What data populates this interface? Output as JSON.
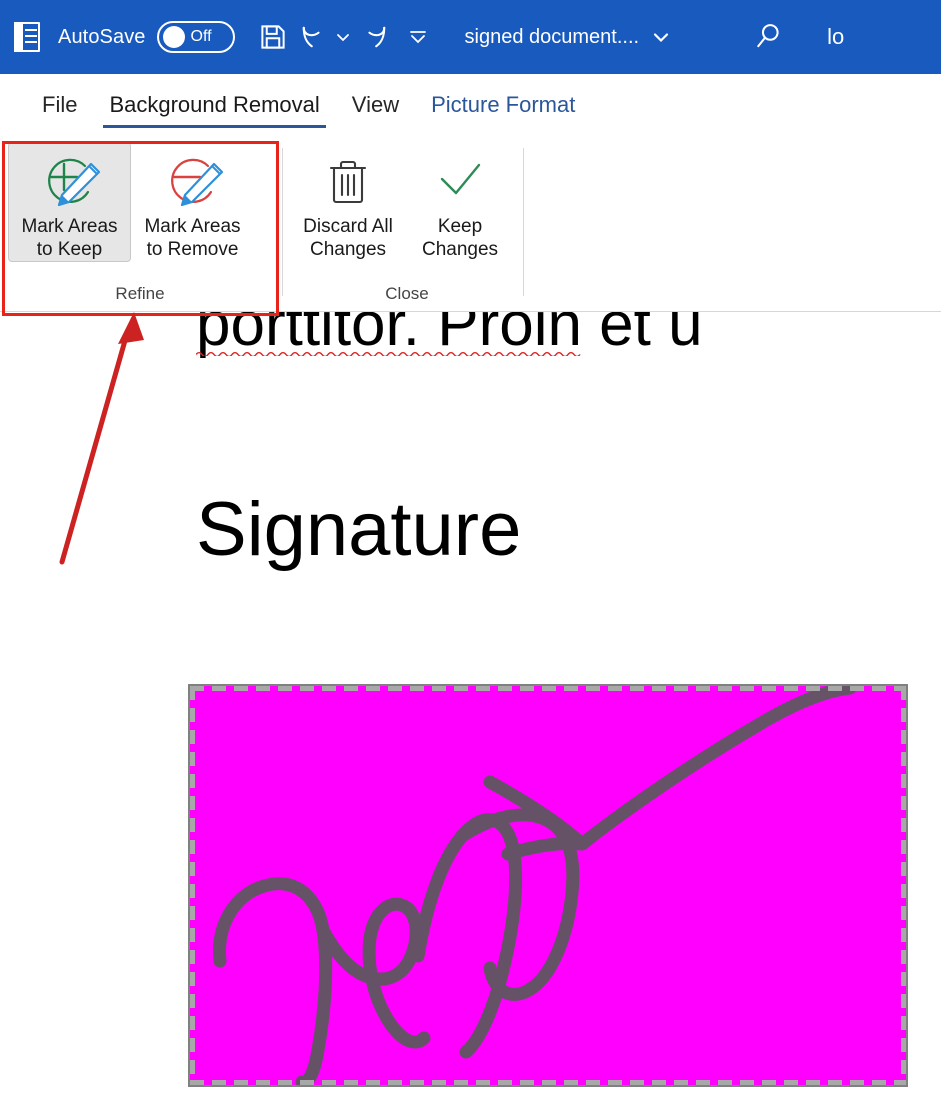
{
  "titlebar": {
    "app_icon": "word-icon",
    "autosave_label": "AutoSave",
    "autosave_state": "Off",
    "save_icon": "save-icon",
    "undo_icon": "undo-icon",
    "undo_dropdown_icon": "chevron-down-icon",
    "redo_icon": "redo-icon",
    "customize_qat_icon": "customize-quick-access-toolbar-icon",
    "document_title": "signed document....",
    "title_dropdown_icon": "chevron-down-icon",
    "search_icon": "search-icon",
    "account_text": "lo",
    "background_color": "#185ABD"
  },
  "tabs": [
    {
      "label": "File",
      "active": false,
      "accent": false
    },
    {
      "label": "Background Removal",
      "active": true,
      "accent": false
    },
    {
      "label": "View",
      "active": false,
      "accent": false
    },
    {
      "label": "Picture Format",
      "active": false,
      "accent": true
    }
  ],
  "ribbon": {
    "groups": [
      {
        "name": "Refine",
        "label": "Refine",
        "buttons": [
          {
            "label": "Mark Areas\nto Keep",
            "icon": "mark-areas-to-keep-icon",
            "selected": true,
            "circle_color": "#1E8449",
            "mark_color": "#1E8449",
            "pencil_color": "#2E90D9"
          },
          {
            "label": "Mark Areas\nto Remove",
            "icon": "mark-areas-to-remove-icon",
            "selected": false,
            "circle_color": "#D9433F",
            "mark_color": "#D9433F",
            "pencil_color": "#2E90D9"
          }
        ]
      },
      {
        "name": "Close",
        "label": "Close",
        "buttons": [
          {
            "label": "Discard All\nChanges",
            "icon": "trash-icon",
            "selected": false,
            "icon_color": "#3B3B3B"
          },
          {
            "label": "Keep\nChanges",
            "icon": "checkmark-icon",
            "selected": false,
            "icon_color": "#2E8B57"
          }
        ]
      }
    ]
  },
  "document": {
    "body_text_fragment": "porttitor. Proin et u",
    "heading": "Signature",
    "spellcheck_underline_color": "#E02020",
    "picture": {
      "name": "signature-image",
      "background_color": "#FF00FF",
      "stroke_color": "#5A5A5A",
      "selected": true
    }
  },
  "annotations": {
    "highlight_box_color": "#E8231A",
    "arrow_color": "#CC2222",
    "highlight_target": "Refine"
  }
}
